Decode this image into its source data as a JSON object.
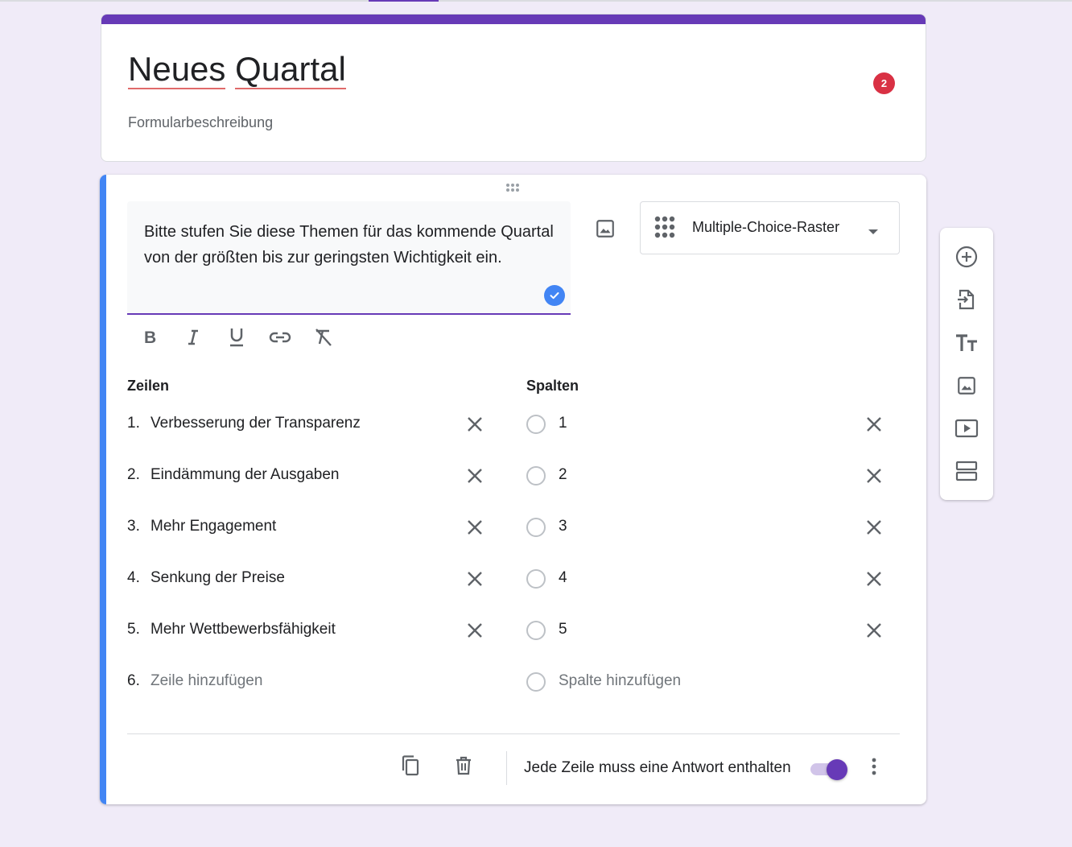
{
  "form": {
    "title_words": [
      "Neues",
      "Quartal"
    ],
    "description_placeholder": "Formularbeschreibung",
    "notification_count": "2"
  },
  "question": {
    "text": "Bitte stufen Sie diese Themen für das kommende Quartal von der größten bis zur geringsten Wichtigkeit ein.",
    "type": "Multiple-Choice-Raster",
    "rows_heading": "Zeilen",
    "columns_heading": "Spalten",
    "rows": [
      {
        "num": "1.",
        "label": "Verbesserung der Transparenz"
      },
      {
        "num": "2.",
        "label": "Eindämmung der Ausgaben"
      },
      {
        "num": "3.",
        "label": "Mehr Engagement"
      },
      {
        "num": "4.",
        "label": "Senkung der Preise"
      },
      {
        "num": "5.",
        "label": "Mehr Wettbewerbsfähigkeit"
      }
    ],
    "add_row": {
      "num": "6.",
      "label": "Zeile hinzufügen"
    },
    "columns": [
      {
        "label": "1"
      },
      {
        "label": "2"
      },
      {
        "label": "3"
      },
      {
        "label": "4"
      },
      {
        "label": "5"
      }
    ],
    "add_column": {
      "label": "Spalte hinzufügen"
    },
    "required_label": "Jede Zeile muss eine Antwort enthalten",
    "required_on": true
  },
  "colors": {
    "accent": "#673ab7",
    "question_bar": "#4285f4",
    "badge": "#d93144",
    "background": "#f0ebf8"
  }
}
